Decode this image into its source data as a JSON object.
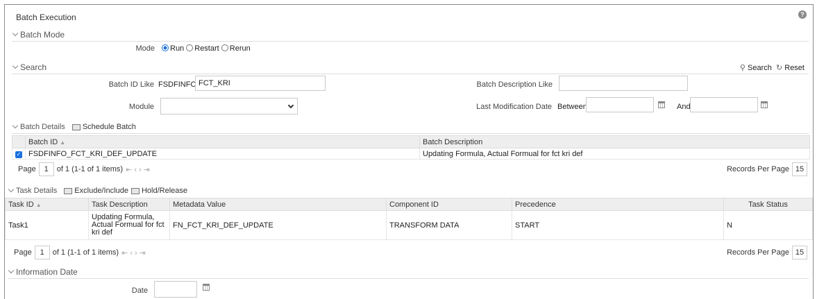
{
  "page": {
    "title": "Batch Execution"
  },
  "batch_mode": {
    "section_label": "Batch Mode",
    "mode_label": "Mode",
    "options": [
      {
        "label": "Run",
        "selected": true
      },
      {
        "label": "Restart",
        "selected": false
      },
      {
        "label": "Rerun",
        "selected": false
      }
    ]
  },
  "search": {
    "section_label": "Search",
    "search_label": "Search",
    "reset_label": "Reset",
    "batch_id_label": "Batch ID Like",
    "batch_id_prefix": "FSDFINFO_",
    "batch_id_value": "FCT_KRI",
    "batch_desc_label": "Batch Description Like",
    "batch_desc_value": "",
    "module_label": "Module",
    "module_value": "",
    "last_mod_label": "Last Modification Date",
    "between_label": "Between",
    "and_label": "And",
    "from_date": "",
    "to_date": ""
  },
  "batch_details": {
    "section_label": "Batch Details",
    "schedule_label": "Schedule Batch",
    "columns": [
      "Batch ID",
      "Batch Description"
    ],
    "rows": [
      {
        "checked": true,
        "batch_id": "FSDFINFO_FCT_KRI_DEF_UPDATE",
        "description": "Updating Formula, Actual Formual for fct kri def"
      }
    ],
    "pager": {
      "page_label": "Page",
      "page": "1",
      "info": "of 1 (1-1 of 1 items)",
      "records_label": "Records Per Page",
      "records": "15"
    }
  },
  "task_details": {
    "section_label": "Task Details",
    "exclude_label": "Exclude/Include",
    "hold_label": "Hold/Release",
    "columns": [
      "Task ID",
      "Task Description",
      "Metadata Value",
      "Component ID",
      "Precedence",
      "Task Status"
    ],
    "rows": [
      {
        "task_id": "Task1",
        "description": "Updating Formula, Actual Formual for fct kri def",
        "metadata": "FN_FCT_KRI_DEF_UPDATE",
        "component": "TRANSFORM DATA",
        "precedence": "START",
        "status": "N"
      }
    ],
    "pager": {
      "page_label": "Page",
      "page": "1",
      "info": "of 1 (1-1 of 1 items)",
      "records_label": "Records Per Page",
      "records": "15"
    }
  },
  "information_date": {
    "section_label": "Information Date",
    "date_label": "Date",
    "date_value": ""
  }
}
